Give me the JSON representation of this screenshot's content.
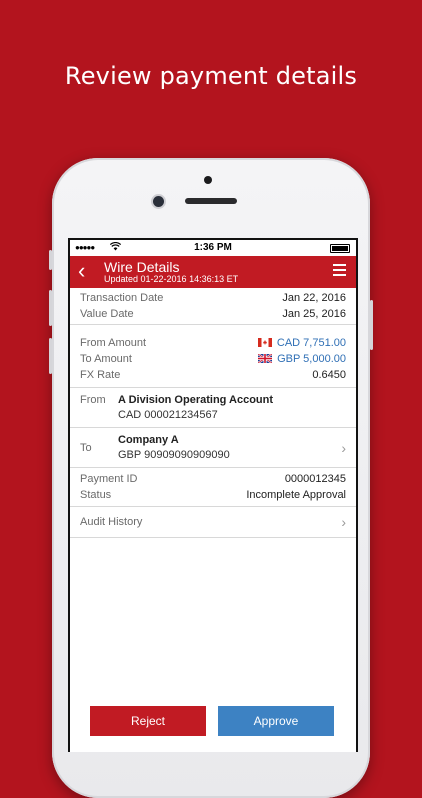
{
  "headline": "Review payment details",
  "status_bar": {
    "signal": "●●●●●",
    "time": "1:36 PM"
  },
  "nav": {
    "title": "Wire Details",
    "subtitle": "Updated  01-22-2016 14:36:13 ET"
  },
  "dates": [
    {
      "label": "Transaction Date",
      "value": "Jan 22, 2016"
    },
    {
      "label": "Value Date",
      "value": "Jan 25, 2016"
    }
  ],
  "amounts": {
    "from_label": "From Amount",
    "from_value": "CAD 7,751.00",
    "to_label": "To Amount",
    "to_value": "GBP 5,000.00",
    "fx_label": "FX Rate",
    "fx_value": "0.6450"
  },
  "from_party": {
    "label": "From",
    "name": "A Division Operating Account",
    "account": "CAD 000021234567"
  },
  "to_party": {
    "label": "To",
    "name": "Company A",
    "account": "GBP 90909090909090"
  },
  "payment": [
    {
      "label": "Payment ID",
      "value": "0000012345"
    },
    {
      "label": "Status",
      "value": "Incomplete Approval"
    }
  ],
  "audit_label": "Audit History",
  "buttons": {
    "reject": "Reject",
    "approve": "Approve"
  },
  "colors": {
    "brand": "#c11b23",
    "approve": "#3d82c3",
    "amount": "#2f6fb5"
  }
}
